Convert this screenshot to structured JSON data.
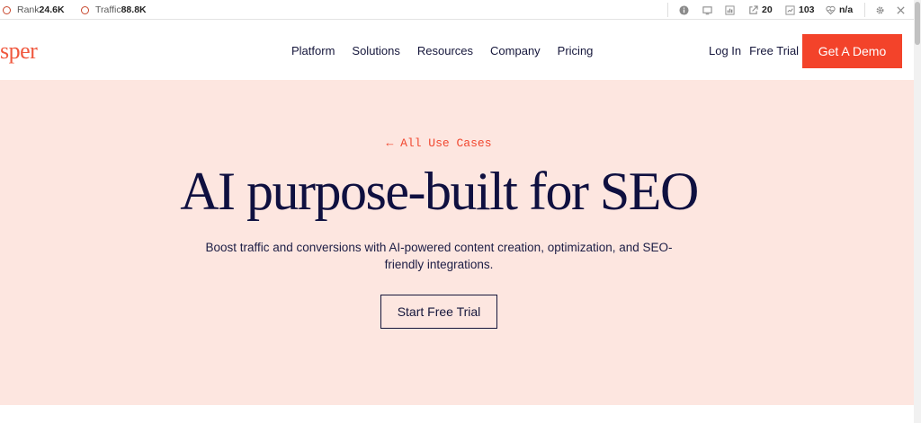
{
  "toolbar": {
    "rank_label": "Rank",
    "rank_value": "24.6K",
    "traffic_label": "Traffic",
    "traffic_value": "88.8K",
    "backlinks_value": "20",
    "pages_value": "103",
    "health_value": "n/a"
  },
  "header": {
    "logo": "sper",
    "nav": [
      "Platform",
      "Solutions",
      "Resources",
      "Company",
      "Pricing"
    ],
    "login": "Log In",
    "free_trial": "Free Trial",
    "demo": "Get A Demo"
  },
  "hero": {
    "back_link": "← All Use Cases",
    "title": "AI purpose-built for SEO",
    "subtitle_line1": "Boost traffic and conversions with AI-powered content creation, optimization, and SEO-",
    "subtitle_line2": "friendly integrations.",
    "cta": "Start Free Trial"
  },
  "colors": {
    "accent": "#f3432a",
    "hero_bg": "#fde6e0",
    "navy": "#15163b"
  }
}
